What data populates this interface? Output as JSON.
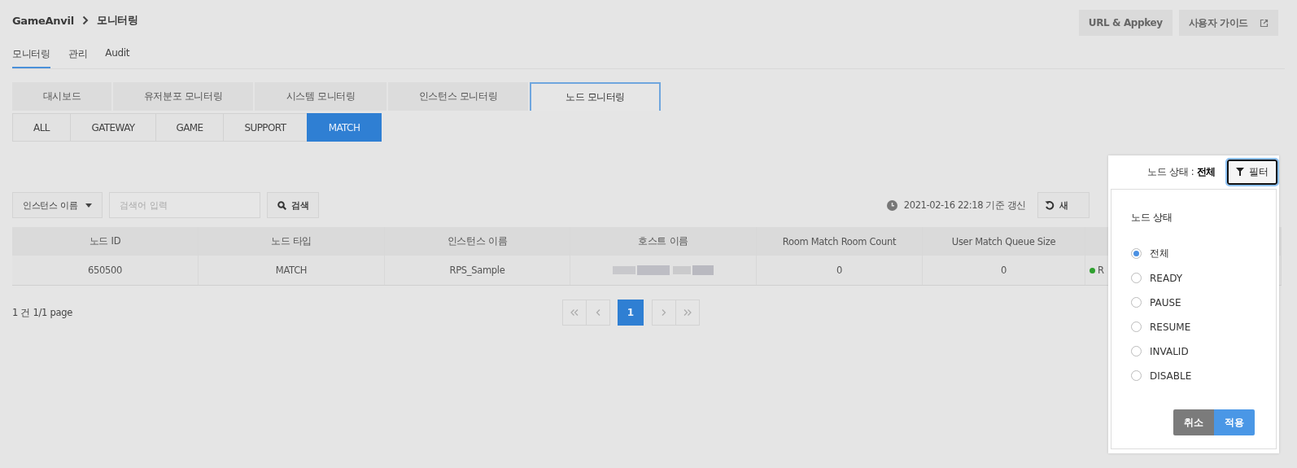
{
  "breadcrumb": [
    {
      "label": "GameAnvil"
    },
    {
      "label": "모니터링"
    }
  ],
  "header_buttons": [
    {
      "label": "URL & Appkey",
      "kind": "plain"
    },
    {
      "label": "사용자 가이드",
      "kind": "external"
    }
  ],
  "main_tabs": [
    {
      "label": "모니터링",
      "selected": true
    },
    {
      "label": "관리",
      "selected": false
    },
    {
      "label": "Audit",
      "selected": false
    }
  ],
  "sub_tabs": [
    {
      "label": "대시보드",
      "selected": false
    },
    {
      "label": "유저분포 모니터링",
      "selected": false
    },
    {
      "label": "시스템 모니터링",
      "selected": false
    },
    {
      "label": "인스턴스 모니터링",
      "selected": false
    },
    {
      "label": "노드 모니터링",
      "selected": true
    }
  ],
  "node_type_tabs": [
    {
      "label": "ALL",
      "selected": false
    },
    {
      "label": "GATEWAY",
      "selected": false
    },
    {
      "label": "GAME",
      "selected": false
    },
    {
      "label": "SUPPORT",
      "selected": false
    },
    {
      "label": "MATCH",
      "selected": true
    }
  ],
  "search": {
    "field_select": "인스턴스 이름",
    "placeholder": "검색어 입력",
    "button": "검색"
  },
  "updated": "2021-02-16 22:18 기준 갱신",
  "refresh_button": "새",
  "table": {
    "columns": [
      "노드 ID",
      "노드 타입",
      "인스턴스 이름",
      "호스트 이름",
      "Room Match Room Count",
      "User Match Queue Size"
    ],
    "rows": [
      {
        "cells": [
          "650500",
          "MATCH",
          "RPS_Sample",
          null,
          "0",
          "0"
        ],
        "status": {
          "label": "R",
          "color": "#2ea02e"
        }
      }
    ]
  },
  "summary": "1 건 1/1 page",
  "pagination": {
    "pages": [
      {
        "label": "1",
        "selected": true
      }
    ]
  },
  "filter": {
    "label": "노드 상태 : ",
    "value": "전체",
    "button": "필터",
    "panel": {
      "title": "노드 상태",
      "options": [
        {
          "label": "전체",
          "selected": true
        },
        {
          "label": "READY",
          "selected": false
        },
        {
          "label": "PAUSE",
          "selected": false
        },
        {
          "label": "RESUME",
          "selected": false
        },
        {
          "label": "INVALID",
          "selected": false
        },
        {
          "label": "DISABLE",
          "selected": false
        }
      ],
      "buttons": [
        {
          "label": "취소",
          "kind": "cancel"
        },
        {
          "label": "적용",
          "kind": "apply"
        }
      ]
    }
  }
}
